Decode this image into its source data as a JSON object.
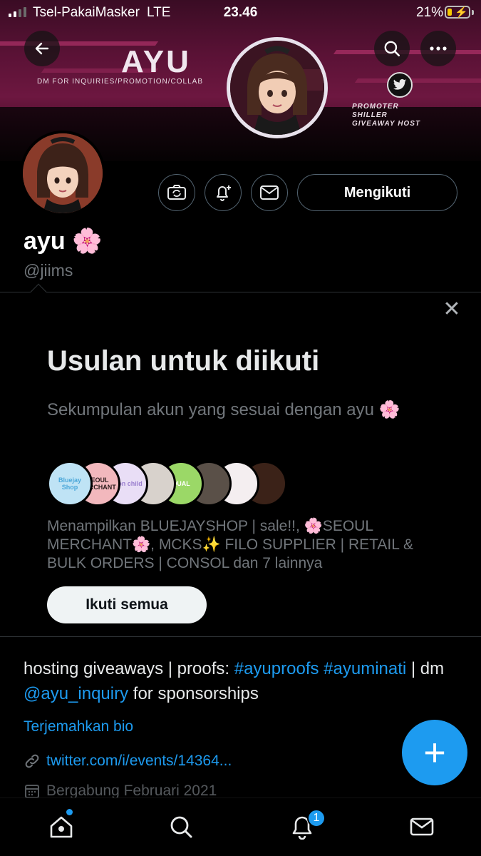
{
  "status_bar": {
    "carrier": "Tsel-PakaiMasker",
    "network": "LTE",
    "time": "23.46",
    "battery_percent": "21%",
    "battery_level": 0.21
  },
  "banner": {
    "title": "AYU",
    "subtitle": "DM FOR INQUIRIES/PROMOTION/COLLAB",
    "tags": [
      "PROMOTER",
      "SHILLER",
      "GIVEAWAY HOST"
    ]
  },
  "header_buttons": {
    "back_icon": "arrow-left-icon",
    "search_icon": "search-icon",
    "more_icon": "more-horizontal-icon"
  },
  "actions": {
    "icons": [
      "camera-switch-icon",
      "bell-plus-icon",
      "mail-icon"
    ],
    "follow_label": "Mengikuti"
  },
  "profile": {
    "name": "ayu 🌸",
    "handle": "@jiims"
  },
  "suggestions": {
    "title": "Usulan untuk diikuti",
    "subtitle": "Sekumpulan akun yang sesuai dengan ayu 🌸",
    "avatars": [
      {
        "label": "Bluejay Shop",
        "color": "#bfe3f5",
        "text": "#4aa7d9"
      },
      {
        "label": "SEOUL MERCHANT",
        "color": "#f2b8bd",
        "text": "#2a1a1a"
      },
      {
        "label": "Moon child",
        "color": "#e9def6",
        "text": "#9b7fcf"
      },
      {
        "label": "",
        "color": "#d8d2cc",
        "text": "#222"
      },
      {
        "label": "QUAL",
        "color": "#9bd867",
        "text": "#ffffff"
      },
      {
        "label": "",
        "color": "#5a5048",
        "text": "#fff"
      },
      {
        "label": "",
        "color": "#f4eef0",
        "text": "#b04060"
      },
      {
        "label": "",
        "color": "#3b2218",
        "text": "#fff"
      }
    ],
    "description": "Menampilkan BLUEJAYSHOP | sale!!, 🌸SEOUL MERCHANT🌸, MCKS✨ FILO SUPPLIER | RETAIL & BULK ORDERS | CONSOL dan 7 lainnya",
    "follow_all_label": "Ikuti semua"
  },
  "bio": {
    "part1": "hosting giveaways | proofs: ",
    "tag1": "#ayuproofs",
    "space": " ",
    "tag2": "#ayuminati",
    "part2": " | dm ",
    "mention": "@ayu_inquiry",
    "part3": " for sponsorships",
    "translate": "Terjemahkan bio",
    "url": "twitter.com/i/events/14364...",
    "joined": "Bergabung Februari 2021"
  },
  "fab": {
    "label": "+"
  },
  "tabbar": {
    "icons": [
      "home-icon",
      "search-icon",
      "bell-icon",
      "mail-icon"
    ],
    "notification_count": "1"
  },
  "colors": {
    "accent": "#1d9bf0",
    "muted": "#71767b"
  }
}
